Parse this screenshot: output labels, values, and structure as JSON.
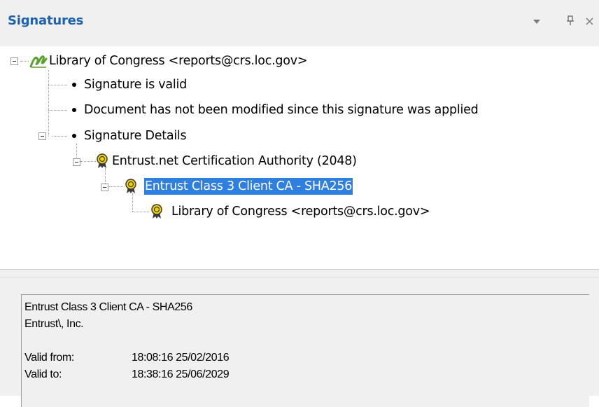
{
  "panel": {
    "title": "Signatures",
    "controls": {
      "menu": "▾",
      "pin": "📌",
      "close": "✕"
    }
  },
  "tree": {
    "signer": "Library of Congress <reports@crs.loc.gov>",
    "status_valid": "Signature is valid",
    "status_unmodified": "Document has not been modified since this signature was applied",
    "details_label": "Signature Details",
    "cert_root": "Entrust.net Certification Authority (2048)",
    "cert_intermediate": "Entrust Class 3 Client CA - SHA256",
    "cert_leaf": "Library of Congress <reports@crs.loc.gov>",
    "selected": "cert_intermediate"
  },
  "details": {
    "name": "Entrust Class 3 Client CA - SHA256",
    "org": "Entrust\\, Inc.",
    "valid_from_label": "Valid from:",
    "valid_from": "18:08:16 25/02/2016",
    "valid_to_label": "Valid to:",
    "valid_to": "18:38:16 25/06/2029"
  },
  "colors": {
    "title": "#1e63b0",
    "selection": "#2f7fe0",
    "signature_icon": "#5aa02c",
    "cert_icon": "#e8c000"
  }
}
